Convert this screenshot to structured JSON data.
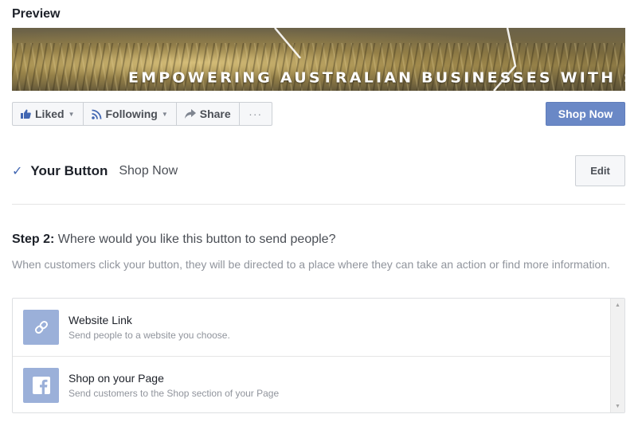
{
  "preview": {
    "title": "Preview",
    "cover_tagline": "EMPOWERING AUSTRALIAN BUSINESSES WITH SEARCH MARKETING"
  },
  "action_bar": {
    "liked_label": "Liked",
    "following_label": "Following",
    "share_label": "Share",
    "more_label": "···",
    "cta_label": "Shop Now"
  },
  "your_button": {
    "heading": "Your Button",
    "value": "Shop Now",
    "edit_label": "Edit"
  },
  "step2": {
    "label": "Step 2:",
    "question": "Where would you like this button to send people?",
    "description": "When customers click your button, they will be directed to a place where they can take an action or find more information."
  },
  "options": [
    {
      "title": "Website Link",
      "subtitle": "Send people to a website you choose.",
      "icon": "link-icon"
    },
    {
      "title": "Shop on your Page",
      "subtitle": "Send customers to the Shop section of your Page",
      "icon": "facebook-icon"
    }
  ],
  "colors": {
    "brand": "#4267b2",
    "cta": "#6a88c6",
    "option_icon_bg": "#9bb0d9"
  }
}
